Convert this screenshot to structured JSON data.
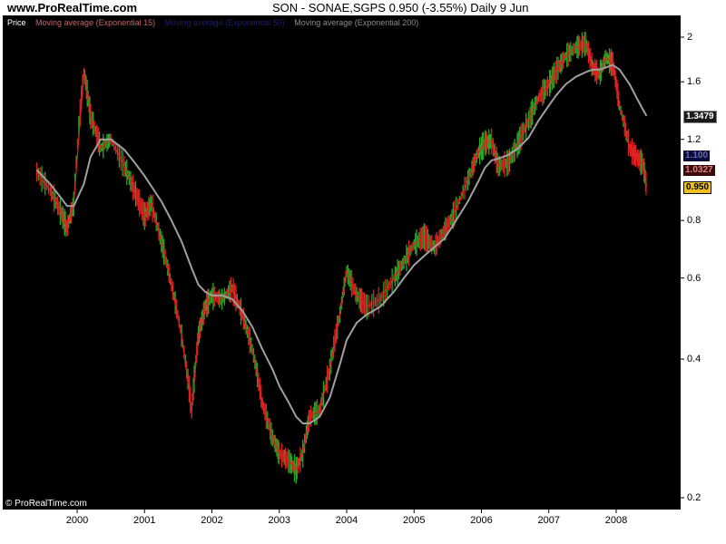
{
  "header": {
    "site": "www.ProRealTime.com",
    "instrument": "SON - SONAE,SGPS   0.950 (-3.55%)   Daily  9 Jun"
  },
  "legend": {
    "price": "Price",
    "ema15": "Moving average (Exponential 15)",
    "ema50": "Moving average (Exponential 50)",
    "ema200": "Moving average (Exponential 200)"
  },
  "copyright": "© ProRealTime.com",
  "colors": {
    "background": "#000000",
    "candle_up": "#22aa22",
    "candle_down": "#dd2222",
    "ema15": "#a03232",
    "ema50": "#181860",
    "ema200": "#a0a0a0",
    "badge_ema200": "#1a1a1a",
    "badge_ema50": "#0a0a3a",
    "badge_ema15": "#3a0a0a",
    "badge_last": "#f0c020"
  },
  "chart_data": {
    "type": "line",
    "scale": "log",
    "x_ticks": [
      "2000",
      "2001",
      "2002",
      "2003",
      "2004",
      "2005",
      "2006",
      "2007",
      "2008"
    ],
    "y_ticks": [
      "2",
      "1.6",
      "1.2",
      "0.8",
      "0.6",
      "0.4",
      "0.2"
    ],
    "ylim": [
      0.2,
      2.05
    ],
    "x": [
      1999.4,
      1999.6,
      1999.75,
      1999.85,
      1999.95,
      2000.1,
      2000.2,
      2000.35,
      2000.5,
      2000.7,
      2000.85,
      2001.0,
      2001.1,
      2001.25,
      2001.4,
      2001.55,
      2001.7,
      2001.8,
      2001.9,
      2002.0,
      2002.15,
      2002.3,
      2002.45,
      2002.6,
      2002.75,
      2002.9,
      2003.0,
      2003.15,
      2003.25,
      2003.35,
      2003.45,
      2003.6,
      2003.75,
      2003.9,
      2004.0,
      2004.15,
      2004.3,
      2004.5,
      2004.7,
      2004.85,
      2005.0,
      2005.15,
      2005.3,
      2005.45,
      2005.6,
      2005.8,
      2005.95,
      2006.05,
      2006.15,
      2006.25,
      2006.4,
      2006.55,
      2006.7,
      2006.85,
      2007.0,
      2007.1,
      2007.25,
      2007.4,
      2007.55,
      2007.65,
      2007.75,
      2007.85,
      2007.95,
      2008.05,
      2008.2,
      2008.3,
      2008.4,
      2008.45
    ],
    "series": [
      {
        "name": "Price",
        "values": [
          1.02,
          0.93,
          0.84,
          0.77,
          0.87,
          1.68,
          1.35,
          1.15,
          1.2,
          1.05,
          0.93,
          0.82,
          0.87,
          0.72,
          0.58,
          0.45,
          0.31,
          0.45,
          0.52,
          0.55,
          0.54,
          0.57,
          0.5,
          0.42,
          0.32,
          0.27,
          0.25,
          0.24,
          0.23,
          0.25,
          0.3,
          0.31,
          0.38,
          0.5,
          0.62,
          0.55,
          0.52,
          0.54,
          0.6,
          0.65,
          0.71,
          0.74,
          0.7,
          0.76,
          0.83,
          0.98,
          1.12,
          1.18,
          1.19,
          1.05,
          1.07,
          1.18,
          1.32,
          1.48,
          1.58,
          1.68,
          1.82,
          1.9,
          1.94,
          1.72,
          1.66,
          1.81,
          1.75,
          1.42,
          1.15,
          1.1,
          1.06,
          0.95
        ]
      },
      {
        "name": "Moving average (Exponential 200)",
        "values": [
          1.03,
          0.96,
          0.9,
          0.86,
          0.86,
          0.96,
          1.1,
          1.2,
          1.2,
          1.14,
          1.07,
          1.0,
          0.95,
          0.88,
          0.8,
          0.72,
          0.63,
          0.58,
          0.56,
          0.55,
          0.55,
          0.54,
          0.51,
          0.47,
          0.42,
          0.38,
          0.35,
          0.32,
          0.3,
          0.29,
          0.29,
          0.3,
          0.33,
          0.39,
          0.44,
          0.48,
          0.5,
          0.52,
          0.56,
          0.6,
          0.64,
          0.67,
          0.7,
          0.73,
          0.79,
          0.88,
          0.97,
          1.04,
          1.08,
          1.09,
          1.11,
          1.15,
          1.21,
          1.32,
          1.42,
          1.49,
          1.58,
          1.64,
          1.68,
          1.7,
          1.7,
          1.72,
          1.74,
          1.7,
          1.58,
          1.48,
          1.39,
          1.35
        ]
      }
    ],
    "last_values": {
      "ema200": "1.3479",
      "ema50": "1.100",
      "ema15": "1.0327",
      "price": "0.950"
    }
  }
}
